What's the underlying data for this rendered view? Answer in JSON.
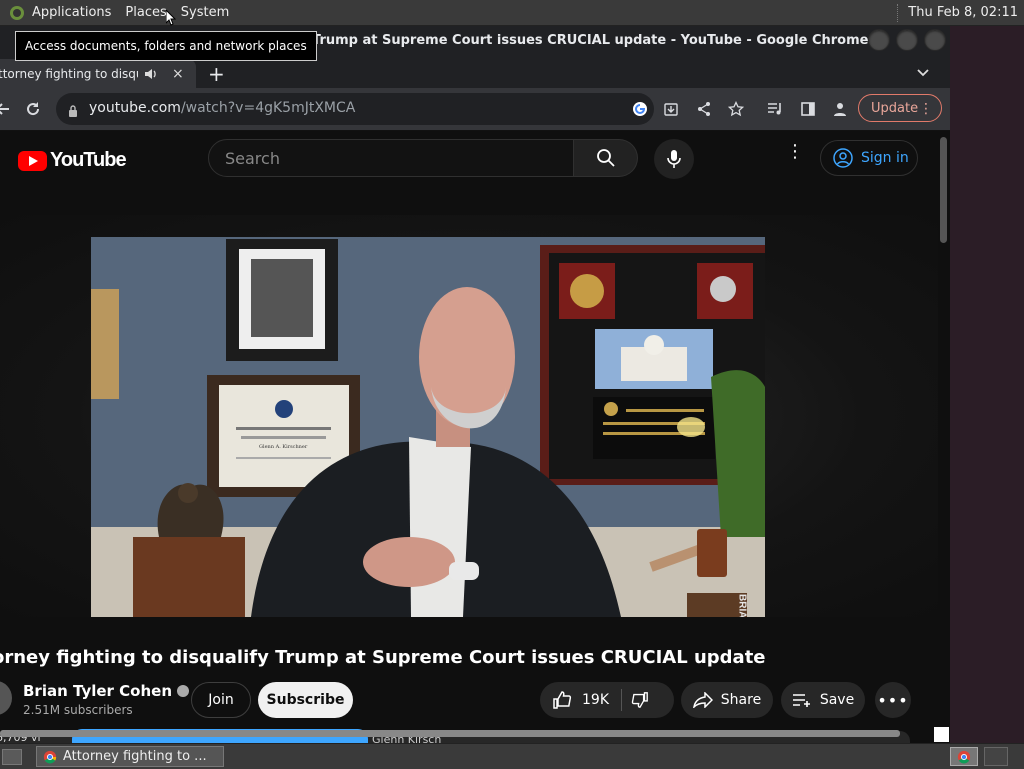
{
  "panel": {
    "menus": [
      "Applications",
      "Places",
      "System"
    ],
    "clock": "Thu Feb  8, 02:11"
  },
  "tooltip": {
    "text": "Access documents, folders and network places"
  },
  "window": {
    "title": "Trump at Supreme Court issues CRUCIAL update - YouTube - Google Chrome"
  },
  "tab": {
    "title": "ttorney fighting to disqu",
    "new_tab_label": "+",
    "close_label": "×"
  },
  "toolbar": {
    "url_host": "youtube.com",
    "url_path": "/watch?v=4gK5mJtXMCA",
    "update_label": "Update"
  },
  "youtube": {
    "logo_text": "YouTube",
    "search_placeholder": "Search",
    "signin_label": "Sign in",
    "video_title": "orney fighting to disqualify Trump at Supreme Court issues CRUCIAL update",
    "channel_name": "Brian Tyler Cohen",
    "subscribers": "2.51M subscribers",
    "join_label": "Join",
    "subscribe_label": "Subscribe",
    "like_count": "19K",
    "share_label": "Share",
    "save_label": "Save",
    "desc_left": "6,709 vi",
    "desc_right": "Glenn Kirsch",
    "watermark": "BRIAN TYLER COHEN",
    "diploma_name": "Glenn A. Kirschner"
  },
  "taskbar": {
    "task_title": "Attorney fighting to ..."
  },
  "colors": {
    "yt_red": "#ff0000",
    "link_blue": "#3ea6ff",
    "update_accent": "#e27a6a"
  }
}
